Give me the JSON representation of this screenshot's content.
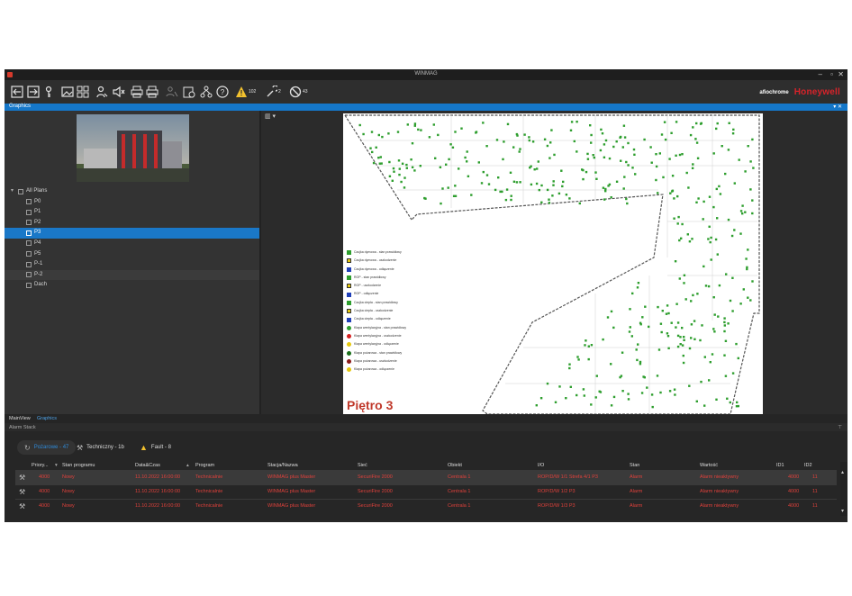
{
  "window": {
    "title": "WINMAG",
    "minimize": "–",
    "restore": "▫",
    "close": "✕"
  },
  "toolbar": {
    "alarm_count": "102",
    "tech_count": "2",
    "blocked_count": "43",
    "brand_aflo": "afiochrome",
    "brand_honeywell": "Honeywell"
  },
  "graphics_panel": {
    "title": "Graphics",
    "controls": "▾ ✕"
  },
  "tree": {
    "root": "All Plans",
    "items": [
      "P0",
      "P1",
      "P2",
      "P3",
      "P4",
      "P5",
      "P-1",
      "P-2",
      "Dach"
    ],
    "selected": "P3"
  },
  "plan": {
    "title": "Piętro 3",
    "legend": [
      {
        "label": "Czujka dymowa - stan prawidłowy",
        "color": "#2e9e2e",
        "kind": "sq"
      },
      {
        "label": "Czujka dymowa - uszkodzenie",
        "color": "#e5c80e",
        "kind": "x"
      },
      {
        "label": "Czujka dymowa - odłączenie",
        "color": "#1f3fb8",
        "kind": "sq"
      },
      {
        "label": "ROP - stan prawidłowy",
        "color": "#2e9e2e",
        "kind": "sq"
      },
      {
        "label": "ROP - uszkodzenie",
        "color": "#e5c80e",
        "kind": "x"
      },
      {
        "label": "ROP - odłączenie",
        "color": "#1f3fb8",
        "kind": "sq"
      },
      {
        "label": "Czujka ciepła - stan prawidłowy",
        "color": "#2e9e2e",
        "kind": "sq"
      },
      {
        "label": "Czujka ciepła - uszkodzenie",
        "color": "#e5c80e",
        "kind": "excl"
      },
      {
        "label": "Czujka ciepła - odłączenie",
        "color": "#1f3fb8",
        "kind": "sq"
      },
      {
        "label": "Klapa wentylacyjna - stan prawidłowy",
        "color": "#2e9e2e",
        "kind": "dot"
      },
      {
        "label": "Klapa wentylacyjna - uszkodzenie",
        "color": "#d42020",
        "kind": "dot"
      },
      {
        "label": "Klapa wentylacyjna - odłączenie",
        "color": "#e5c80e",
        "kind": "dot"
      },
      {
        "label": "Klapa pożarowa - stan prawidłowy",
        "color": "#1a6e1a",
        "kind": "dot"
      },
      {
        "label": "Klapa pożarowa - uszkodzenie",
        "color": "#8a1a1a",
        "kind": "dot"
      },
      {
        "label": "Klapa pożarowa - odłączenie",
        "color": "#e5c80e",
        "kind": "dot"
      }
    ]
  },
  "view_tabs": {
    "main": "MainView",
    "graphics": "Graphics"
  },
  "alarm_panel": {
    "title": "Alarm Stack",
    "tabs": [
      {
        "label": "Pożarowe - 47"
      },
      {
        "label": "Techniczny - 1b"
      },
      {
        "label": "Fault - 8"
      }
    ],
    "columns": [
      "Priory...",
      "Stan programu",
      "Data&Czas",
      "Program",
      "Stacja/Nazwa",
      "Sieć",
      "Obiekt",
      "I/O",
      "Stan",
      "Wartość",
      "ID1",
      "ID2"
    ],
    "rows": [
      [
        "4000",
        "Nowy",
        "11.10.2022 16:00:00",
        "Technicalnie",
        "WINMAG plus Master",
        "SecuriFire 2000",
        "Centrala 1",
        "ROP/D/W 1/1 Strefa 4/1 P3",
        "Alarm",
        "Alarm nieaktywny",
        "4000",
        "11"
      ],
      [
        "4000",
        "Nowy",
        "11.10.2022 16:00:00",
        "Technicalnie",
        "WINMAG plus Master",
        "SecuriFire 2000",
        "Centrala 1",
        "ROP/D/W 1/2 P3",
        "Alarm",
        "Alarm nieaktywny",
        "4000",
        "11"
      ],
      [
        "4000",
        "Nowy",
        "11.10.2022 16:00:00",
        "Technicalnie",
        "WINMAG plus Master",
        "SecuriFire 2000",
        "Centrala 1",
        "ROP/D/W 1/3 P3",
        "Alarm",
        "Alarm nieaktywny",
        "4000",
        "11"
      ]
    ]
  },
  "colors": {
    "accent": "#1577c9",
    "alarm_text": "#e0413b",
    "brand": "#d8232a",
    "background": "#2b2b2b"
  }
}
